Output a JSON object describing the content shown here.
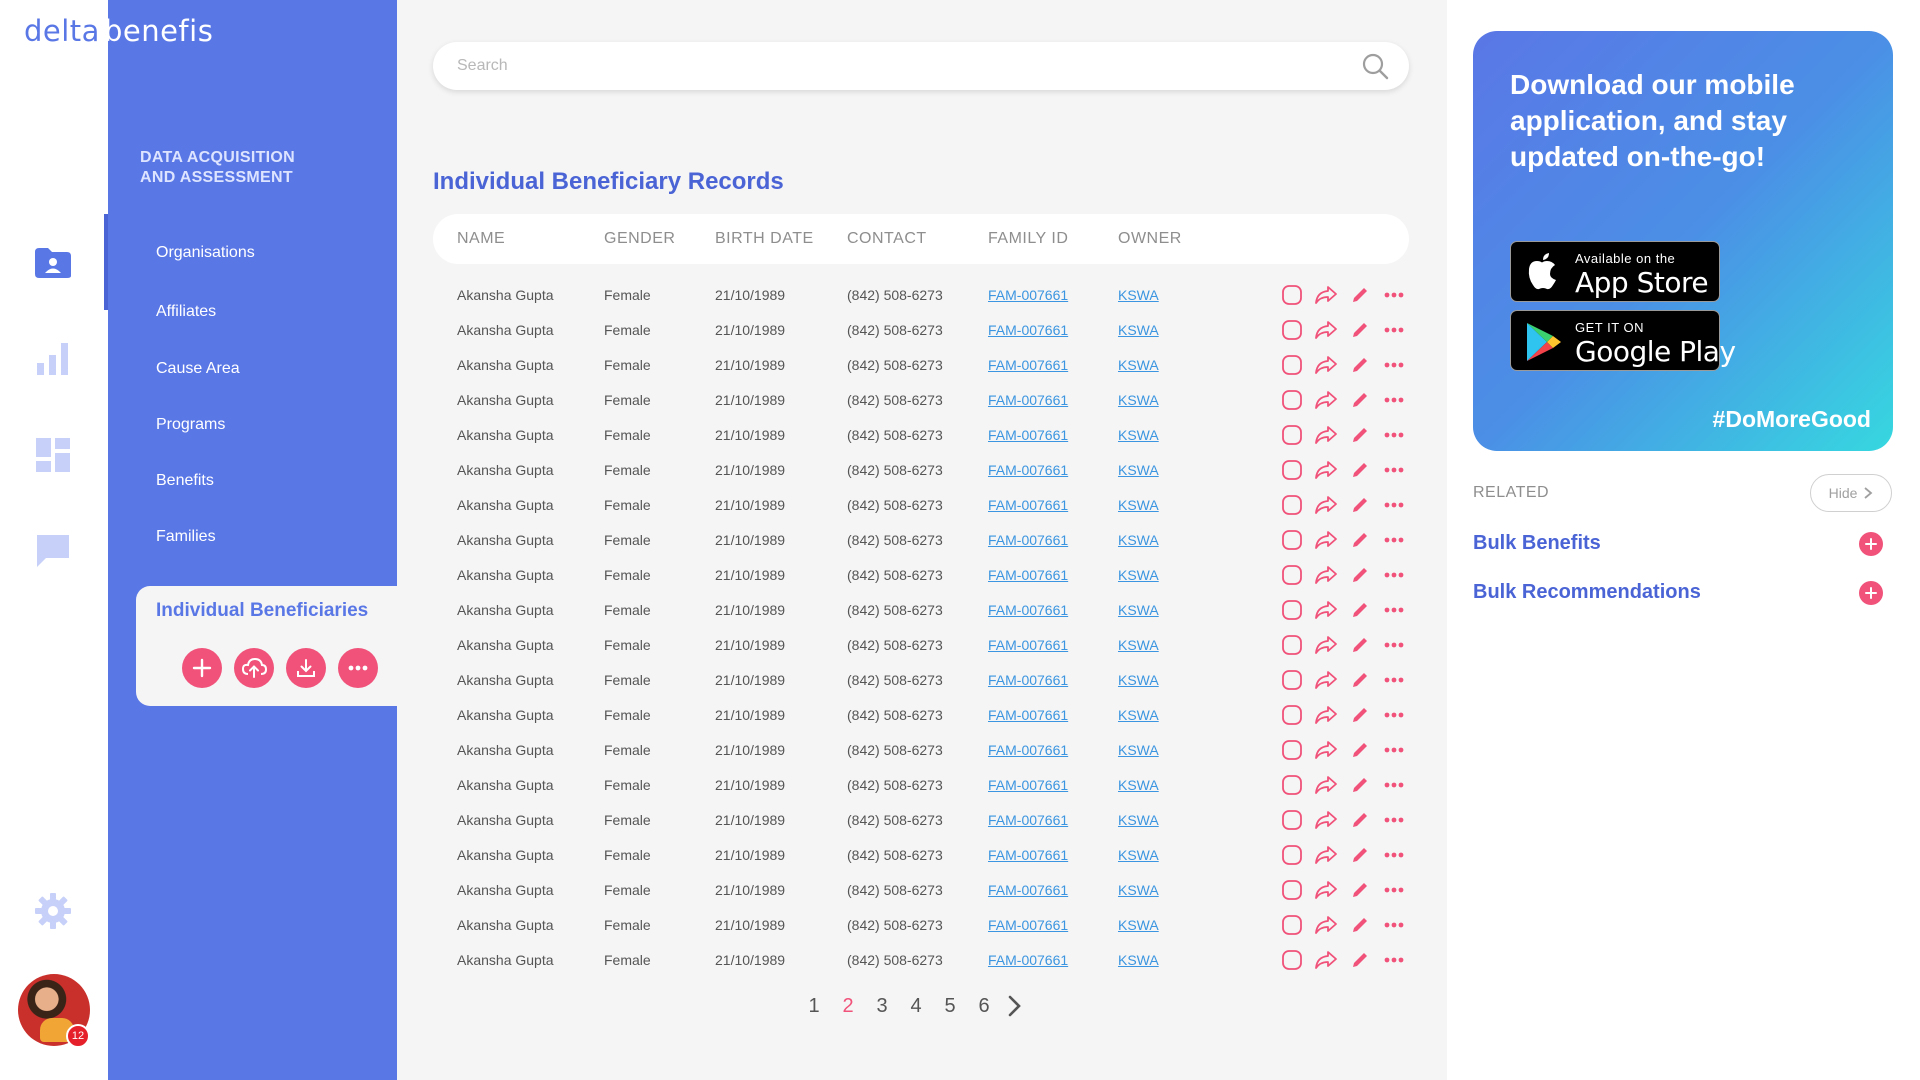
{
  "brand": {
    "part1": "delta",
    "part2": "benefis"
  },
  "rail": {
    "icons": [
      "folder-user-icon",
      "bar-chart-icon",
      "dashboard-icon",
      "chat-icon",
      "gear-icon"
    ],
    "notifications": "12"
  },
  "nav": {
    "section_title_line1": "DATA ACQUISITION",
    "section_title_line2": "AND ASSESSMENT",
    "items": [
      "Organisations",
      "Affiliates",
      "Cause Area",
      "Programs",
      "Benefits",
      "Families"
    ],
    "active": "Individual Beneficiaries",
    "active_actions": [
      "plus-icon",
      "upload-cloud-icon",
      "download-icon",
      "more-icon"
    ]
  },
  "search": {
    "placeholder": "Search"
  },
  "page_title": "Individual Beneficiary Records",
  "table": {
    "columns": [
      "NAME",
      "GENDER",
      "BIRTH DATE",
      "CONTACT",
      "FAMILY ID",
      "OWNER"
    ],
    "rows": [
      [
        "Akansha Gupta",
        "Female",
        "21/10/1989",
        "(842) 508-6273",
        "FAM-007661",
        "KSWA"
      ],
      [
        "Akansha Gupta",
        "Female",
        "21/10/1989",
        "(842) 508-6273",
        "FAM-007661",
        "KSWA"
      ],
      [
        "Akansha Gupta",
        "Female",
        "21/10/1989",
        "(842) 508-6273",
        "FAM-007661",
        "KSWA"
      ],
      [
        "Akansha Gupta",
        "Female",
        "21/10/1989",
        "(842) 508-6273",
        "FAM-007661",
        "KSWA"
      ],
      [
        "Akansha Gupta",
        "Female",
        "21/10/1989",
        "(842) 508-6273",
        "FAM-007661",
        "KSWA"
      ],
      [
        "Akansha Gupta",
        "Female",
        "21/10/1989",
        "(842) 508-6273",
        "FAM-007661",
        "KSWA"
      ],
      [
        "Akansha Gupta",
        "Female",
        "21/10/1989",
        "(842) 508-6273",
        "FAM-007661",
        "KSWA"
      ],
      [
        "Akansha Gupta",
        "Female",
        "21/10/1989",
        "(842) 508-6273",
        "FAM-007661",
        "KSWA"
      ],
      [
        "Akansha Gupta",
        "Female",
        "21/10/1989",
        "(842) 508-6273",
        "FAM-007661",
        "KSWA"
      ],
      [
        "Akansha Gupta",
        "Female",
        "21/10/1989",
        "(842) 508-6273",
        "FAM-007661",
        "KSWA"
      ],
      [
        "Akansha Gupta",
        "Female",
        "21/10/1989",
        "(842) 508-6273",
        "FAM-007661",
        "KSWA"
      ],
      [
        "Akansha Gupta",
        "Female",
        "21/10/1989",
        "(842) 508-6273",
        "FAM-007661",
        "KSWA"
      ],
      [
        "Akansha Gupta",
        "Female",
        "21/10/1989",
        "(842) 508-6273",
        "FAM-007661",
        "KSWA"
      ],
      [
        "Akansha Gupta",
        "Female",
        "21/10/1989",
        "(842) 508-6273",
        "FAM-007661",
        "KSWA"
      ],
      [
        "Akansha Gupta",
        "Female",
        "21/10/1989",
        "(842) 508-6273",
        "FAM-007661",
        "KSWA"
      ],
      [
        "Akansha Gupta",
        "Female",
        "21/10/1989",
        "(842) 508-6273",
        "FAM-007661",
        "KSWA"
      ],
      [
        "Akansha Gupta",
        "Female",
        "21/10/1989",
        "(842) 508-6273",
        "FAM-007661",
        "KSWA"
      ],
      [
        "Akansha Gupta",
        "Female",
        "21/10/1989",
        "(842) 508-6273",
        "FAM-007661",
        "KSWA"
      ],
      [
        "Akansha Gupta",
        "Female",
        "21/10/1989",
        "(842) 508-6273",
        "FAM-007661",
        "KSWA"
      ],
      [
        "Akansha Gupta",
        "Female",
        "21/10/1989",
        "(842) 508-6273",
        "FAM-007661",
        "KSWA"
      ]
    ],
    "row_actions": [
      "checkbox",
      "share-icon",
      "edit-icon",
      "more-icon"
    ]
  },
  "pagination": {
    "pages": [
      "1",
      "2",
      "3",
      "4",
      "5",
      "6"
    ],
    "current": "2"
  },
  "promo": {
    "headline": "Download our mobile application, and stay updated on-the-go!",
    "appstore_small": "Available on the",
    "appstore_big": "App Store",
    "googleplay_small": "GET IT ON",
    "googleplay_big": "Google Play",
    "hashtag": "#DoMoreGood"
  },
  "related": {
    "label": "RELATED",
    "hide_label": "Hide",
    "links": [
      "Bulk Benefits",
      "Bulk Recommendations"
    ]
  },
  "colors": {
    "brand_blue": "#5A77E6",
    "accent_pink": "#F0527A",
    "link_blue": "#3B95E0",
    "title_blue": "#4A64D6"
  }
}
